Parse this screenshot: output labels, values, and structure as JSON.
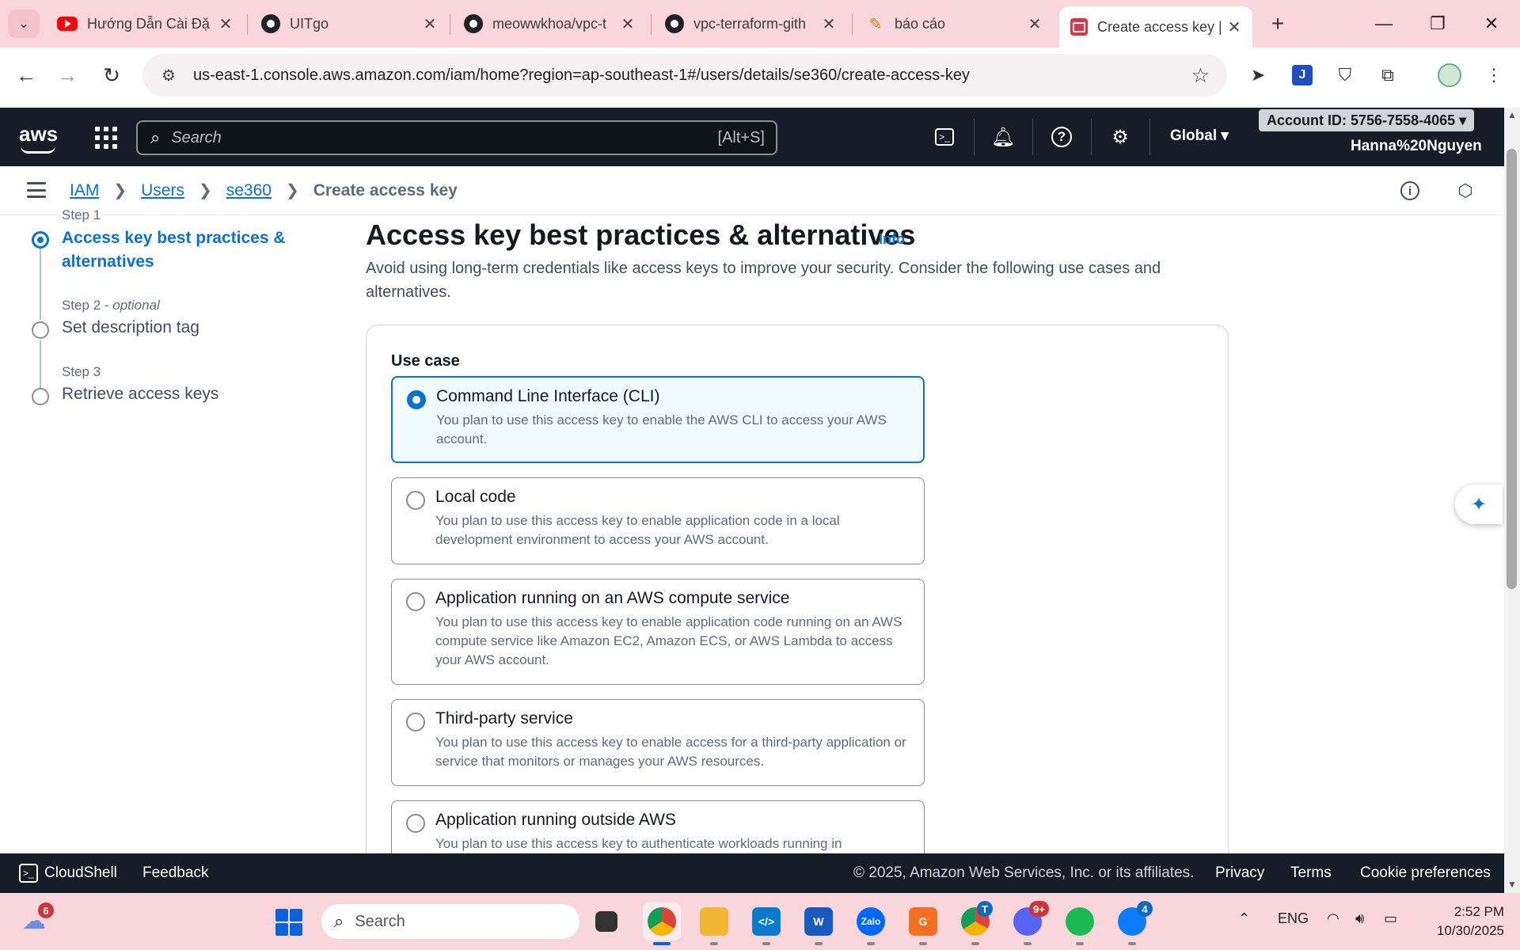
{
  "browser": {
    "tabs": [
      {
        "title": "Hướng Dẫn Cài Đặ",
        "icon": "youtube-icon"
      },
      {
        "title": "UITgo",
        "icon": "github-icon"
      },
      {
        "title": "meowwkhoa/vpc-t",
        "icon": "github-icon"
      },
      {
        "title": "vpc-terraform-gith",
        "icon": "github-icon"
      },
      {
        "title": "báo cáo",
        "icon": "pen-icon"
      },
      {
        "title": "Create access key |",
        "icon": "aws-console-icon",
        "active": true
      }
    ],
    "close_glyph": "✕",
    "new_tab_glyph": "+",
    "url": "us-east-1.console.aws.amazon.com/iam/home?region=ap-southeast-1#/users/details/se360/create-access-key"
  },
  "aws_header": {
    "search_placeholder": "Search",
    "search_shortcut": "[Alt+S]",
    "region": "Global",
    "account_id": "Account ID: 5756-7558-4065",
    "user": "Hanna%20Nguyen"
  },
  "breadcrumbs": {
    "items": [
      "IAM",
      "Users",
      "se360"
    ],
    "current": "Create access key"
  },
  "steps": {
    "cut_label": "Step 1",
    "step1_title": "Access key best practices & alternatives",
    "step2_num": "Step 2 - ",
    "step2_optional": "optional",
    "step2_title": "Set description tag",
    "step3_num": "Step 3",
    "step3_title": "Retrieve access keys"
  },
  "main": {
    "title": "Access key best practices & alternatives",
    "info": "Info",
    "description": "Avoid using long-term credentials like access keys to improve your security. Consider the following use cases and alternatives.",
    "use_case_label": "Use case",
    "options": [
      {
        "title": "Command Line Interface (CLI)",
        "desc": "You plan to use this access key to enable the AWS CLI to access your AWS account.",
        "selected": true
      },
      {
        "title": "Local code",
        "desc": "You plan to use this access key to enable application code in a local development environment to access your AWS account.",
        "selected": false
      },
      {
        "title": "Application running on an AWS compute service",
        "desc": "You plan to use this access key to enable application code running on an AWS compute service like Amazon EC2, Amazon ECS, or AWS Lambda to access your AWS account.",
        "selected": false
      },
      {
        "title": "Third-party service",
        "desc": "You plan to use this access key to enable access for a third-party application or service that monitors or manages your AWS resources.",
        "selected": false
      },
      {
        "title": "Application running outside AWS",
        "desc": "You plan to use this access key to authenticate workloads running in",
        "selected": false
      }
    ]
  },
  "footer": {
    "cloudshell": "CloudShell",
    "feedback": "Feedback",
    "copyright": "© 2025, Amazon Web Services, Inc. or its affiliates.",
    "privacy": "Privacy",
    "terms": "Terms",
    "cookies": "Cookie preferences"
  },
  "taskbar": {
    "weather_badge": "6",
    "search_placeholder": "Search",
    "chrome2_badge": "T",
    "discord_badge": "9+",
    "messenger_badge": "4",
    "zalo_label": "Zalo",
    "language": "ENG",
    "time": "2:52 PM",
    "date": "10/30/2025"
  },
  "colors": {
    "accent": "#0972d3",
    "aws_header_bg": "#161d26",
    "browser_chrome": "#f9d5dc"
  }
}
